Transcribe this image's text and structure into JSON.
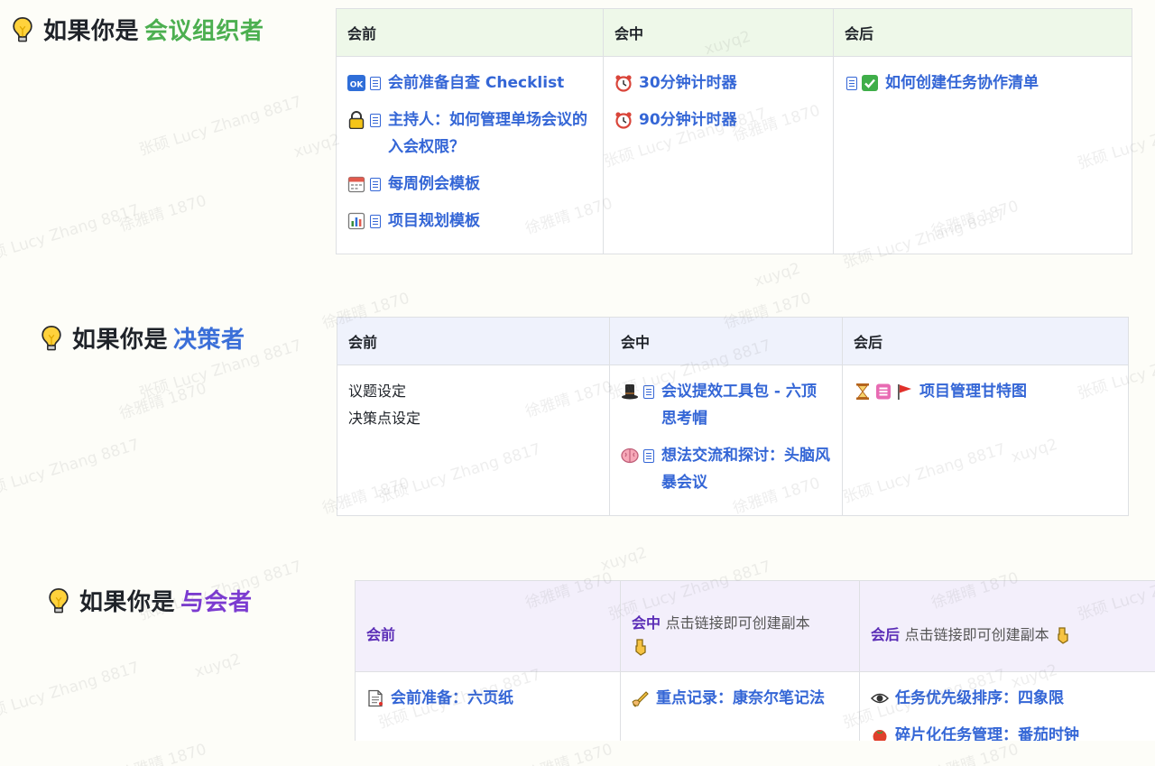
{
  "watermark_texts": [
    "张硕 Lucy Zhang 8817",
    "徐雅晴 1870",
    "xuyq2"
  ],
  "sections": [
    {
      "heading_prefix": "如果你是",
      "heading_role": "会议组织者",
      "columns": [
        "会前",
        "会中",
        "会后"
      ],
      "pre": [
        {
          "icons": [
            "ok-icon",
            "doc-icon"
          ],
          "text": "会前准备自查 Checklist"
        },
        {
          "icons": [
            "lock-icon",
            "doc-icon"
          ],
          "text": "主持人：如何管理单场会议的入会权限？"
        },
        {
          "icons": [
            "calendar-icon",
            "doc-icon"
          ],
          "text": "每周例会模板"
        },
        {
          "icons": [
            "bar-chart-icon",
            "doc-icon"
          ],
          "text": "项目规划模板"
        }
      ],
      "mid": [
        {
          "icons": [
            "alarm-clock-icon"
          ],
          "text": "30分钟计时器"
        },
        {
          "icons": [
            "alarm-clock-icon"
          ],
          "text": "90分钟计时器"
        }
      ],
      "post": [
        {
          "icons": [
            "doc-icon",
            "check-box-icon"
          ],
          "text": "如何创建任务协作清单"
        }
      ]
    },
    {
      "heading_prefix": "如果你是",
      "heading_role": "决策者",
      "columns": [
        "会前",
        "会中",
        "会后"
      ],
      "pre_lines": [
        "议题设定",
        "决策点设定"
      ],
      "mid": [
        {
          "icons": [
            "top-hat-icon",
            "doc-icon"
          ],
          "text": "会议提效工具包 - 六顶思考帽"
        },
        {
          "icons": [
            "brain-icon",
            "doc-icon"
          ],
          "text": "想法交流和探讨：头脑风暴会议"
        }
      ],
      "post": [
        {
          "icons": [
            "hourglass-icon",
            "sheet-icon",
            "red-flag-icon"
          ],
          "text": "项目管理甘特图"
        }
      ]
    },
    {
      "heading_prefix": "如果你是",
      "heading_role": "与会者",
      "columns": [
        "会前",
        "会中",
        "会后"
      ],
      "col_note": "点击链接即可创建副本",
      "pre": [
        {
          "icons": [
            "page-icon"
          ],
          "text": "会前准备：六页纸"
        }
      ],
      "mid": [
        {
          "icons": [
            "writing-hand-icon"
          ],
          "text": "重点记录：康奈尔笔记法"
        }
      ],
      "post": [
        {
          "icons": [
            "eye-icon"
          ],
          "text": "任务优先级排序：四象限"
        },
        {
          "icons": [
            "tomato-icon"
          ],
          "text": "碎片化任务管理：番茄时钟"
        }
      ]
    }
  ],
  "colors": {
    "green": "#4caf50",
    "blue": "#3b6fd8",
    "purple": "#7b3bd0",
    "link": "#3466d6"
  }
}
